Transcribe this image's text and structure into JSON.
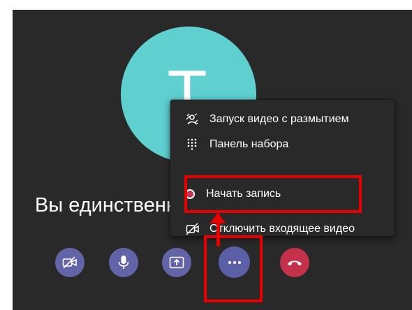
{
  "participant": {
    "initial": "T",
    "avatar_color": "#5fcfd0"
  },
  "status_text": "Вы единственный",
  "menu": {
    "items": [
      {
        "label": "Запуск видео с размытием",
        "icon": "blur-background-icon"
      },
      {
        "label": "Панель набора",
        "icon": "dialpad-icon"
      },
      {
        "label": "Начать запись",
        "icon": "record-icon"
      },
      {
        "label": "Отключить входящее видео",
        "icon": "video-off-icon"
      }
    ]
  },
  "controls": [
    {
      "name": "camera-toggle-button",
      "icon": "video-off-icon"
    },
    {
      "name": "microphone-button",
      "icon": "microphone-icon"
    },
    {
      "name": "share-screen-button",
      "icon": "share-screen-icon"
    },
    {
      "name": "more-actions-button",
      "icon": "more-icon"
    },
    {
      "name": "hang-up-button",
      "icon": "hang-up-icon"
    }
  ],
  "colors": {
    "stage": "#292929",
    "control_button": "#6264a7",
    "hang_up": "#c4314b",
    "record": "#c4314b",
    "annotation": "#e80000"
  }
}
